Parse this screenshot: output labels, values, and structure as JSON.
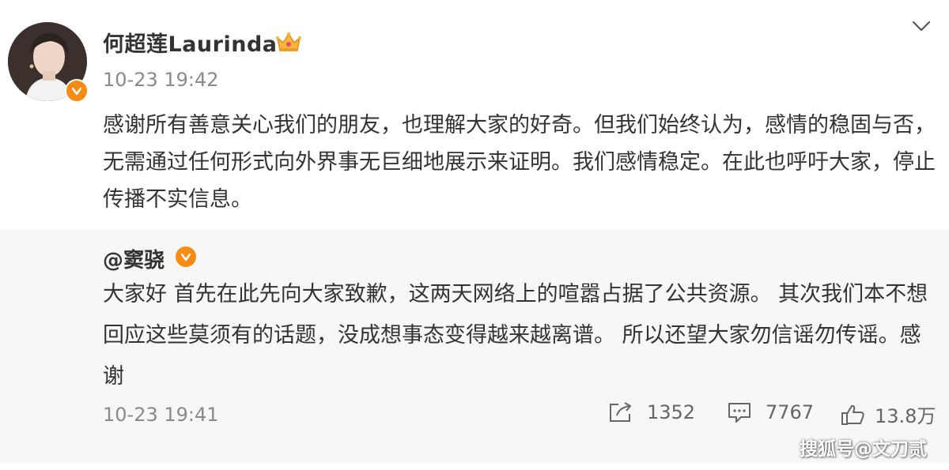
{
  "post": {
    "author": "何超莲Laurinda",
    "timestamp": "10-23 19:42",
    "body": "感谢所有善意关心我们的朋友，也理解大家的好奇。但我们始终认为，感情的稳固与否，无需通过任何形式向外界事无巨细地展示来证明。我们感情稳定。在此也呼吁大家，停止传播不实信息。",
    "icons": {
      "avatar": "avatar",
      "verified": "verified-v-icon",
      "member": "crown-icon",
      "more": "chevron-down-icon"
    }
  },
  "repost": {
    "author": "@窦骁",
    "body": "大家好 首先在此先向大家致歉，这两天网络上的喧嚣占据了公共资源。 其次我们本不想回应这些莫须有的话题，没成想事态变得越来越离谱。 所以还望大家勿信谣勿传谣。感谢",
    "timestamp": "10-23 19:41",
    "actions": [
      {
        "icon": "share-icon",
        "count": "1352"
      },
      {
        "icon": "comment-icon",
        "count": "7767"
      },
      {
        "icon": "thumbs-up-icon",
        "count": "13.8万"
      }
    ]
  },
  "watermark": "搜狐号@文刀贰",
  "colors": {
    "accent": "#f78b14",
    "text": "#333333",
    "muted": "#8a8a8a",
    "repost_bg": "#f7f7f7"
  }
}
